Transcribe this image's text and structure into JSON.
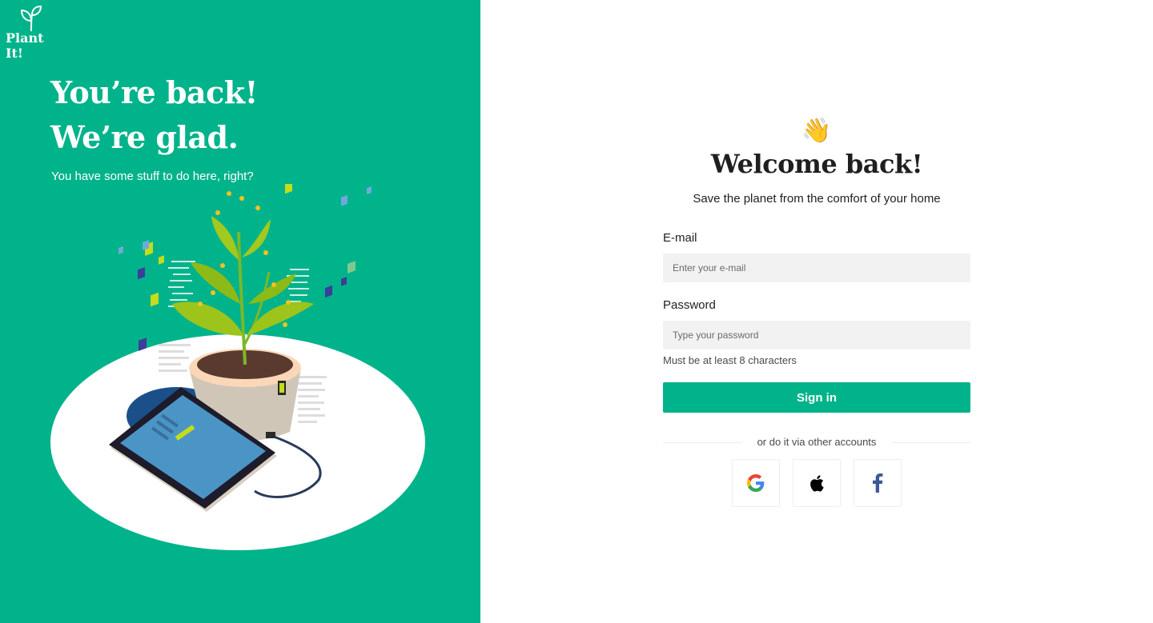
{
  "brand": {
    "name": "Plant It!",
    "color": "#00b38a"
  },
  "hero": {
    "title_line1": "You’re back!",
    "title_line2": "We’re glad.",
    "subtitle": "You have some stuff to do here, right?"
  },
  "login": {
    "emoji": "👋",
    "title": "Welcome back!",
    "tagline": "Save the planet from the comfort of your home",
    "email": {
      "label": "E-mail",
      "placeholder": "Enter your e-mail",
      "value": ""
    },
    "password": {
      "label": "Password",
      "placeholder": "Type your password",
      "value": "",
      "hint": "Must be at least 8 characters"
    },
    "submit_label": "Sign in",
    "divider_text": "or do it via other accounts",
    "social_providers": [
      {
        "name": "Google",
        "icon": "google-icon"
      },
      {
        "name": "Apple",
        "icon": "apple-icon"
      },
      {
        "name": "Facebook",
        "icon": "facebook-icon"
      }
    ]
  }
}
